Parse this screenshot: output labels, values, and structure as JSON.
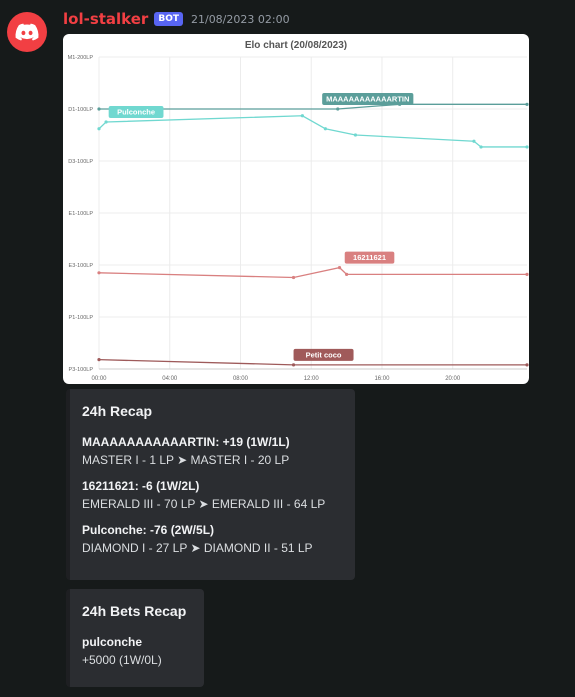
{
  "message": {
    "username": "lol-stalker",
    "bot_tag": "BOT",
    "timestamp": "21/08/2023 02:00",
    "avatar_icon": "discord-logo-icon",
    "username_color": "#f23f43"
  },
  "chart_data": {
    "type": "line",
    "title": "Elo chart (20/08/2023)",
    "x_ticks": [
      "00:00",
      "04:00",
      "08:00",
      "12:00",
      "16:00",
      "20:00"
    ],
    "y_ticks": [
      "M1-200LP",
      "D1-100LP",
      "D3-100LP",
      "E1-100LP",
      "E3-100LP",
      "P1-100LP",
      "P3-100LP"
    ],
    "x_range_hours": [
      0,
      24.2
    ],
    "y_range": [
      0,
      6
    ],
    "series": [
      {
        "name": "MAAAAAAAAAAARTIN",
        "color": "#5b9e9a",
        "label_color": "#5b9e9a",
        "label_point": 1,
        "points": [
          [
            0,
            1.0
          ],
          [
            13.5,
            1.0
          ],
          [
            17.0,
            0.91
          ],
          [
            24.2,
            0.91
          ]
        ]
      },
      {
        "name": "Pulconche",
        "color": "#70d8d0",
        "label_color": "#70d8d0",
        "label_point": 1,
        "points": [
          [
            0,
            1.38
          ],
          [
            0.4,
            1.25
          ],
          [
            11.5,
            1.13
          ],
          [
            12.8,
            1.38
          ],
          [
            14.5,
            1.5
          ],
          [
            21.2,
            1.62
          ],
          [
            21.6,
            1.73
          ],
          [
            24.2,
            1.73
          ]
        ]
      },
      {
        "name": "16211621",
        "color": "#d98080",
        "label_color": "#d98080",
        "label_point": 2,
        "points": [
          [
            0,
            4.15
          ],
          [
            11,
            4.24
          ],
          [
            13.6,
            4.05
          ],
          [
            14.0,
            4.18
          ],
          [
            24.2,
            4.18
          ]
        ]
      },
      {
        "name": "Petit coco",
        "color": "#9e5a5a",
        "label_color": "#a05a5a",
        "label_point": 1,
        "points": [
          [
            0,
            5.82
          ],
          [
            11,
            5.92
          ],
          [
            24.2,
            5.92
          ]
        ]
      }
    ],
    "grid": true
  },
  "recap": {
    "title": "24h Recap",
    "fields": [
      {
        "name": "MAAAAAAAAAAARTIN: +19 (1W/1L)",
        "value": "MASTER I - 1 LP ➤ MASTER I - 20 LP"
      },
      {
        "name": "16211621: -6 (1W/2L)",
        "value": "EMERALD III - 70 LP ➤ EMERALD III - 64 LP"
      },
      {
        "name": "Pulconche: -76 (2W/5L)",
        "value": "DIAMOND I - 27 LP ➤ DIAMOND II - 51 LP"
      }
    ]
  },
  "bets": {
    "title": "24h Bets Recap",
    "fields": [
      {
        "name": "pulconche",
        "value": "+5000 (1W/0L)"
      }
    ]
  }
}
